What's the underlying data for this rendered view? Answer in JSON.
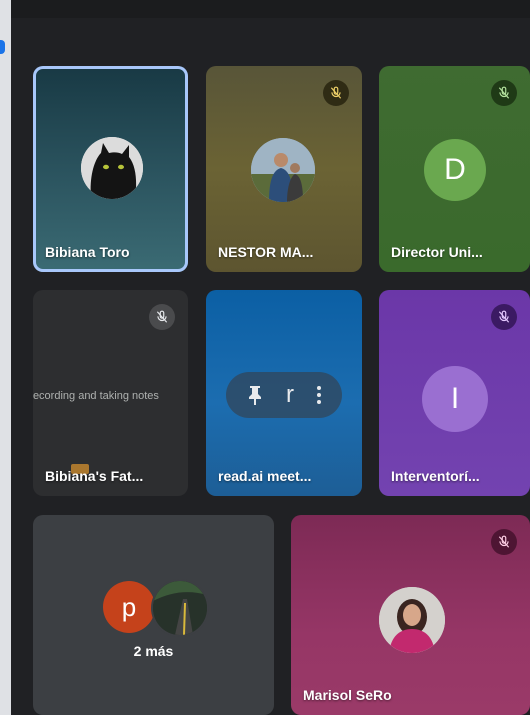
{
  "participants": [
    {
      "name": "Bibiana Toro"
    },
    {
      "name": "NESTOR MA..."
    },
    {
      "name": "Director Uni...",
      "initial": "D"
    },
    {
      "name": "Bibiana's Fat...",
      "caption": "Recording and taking notes"
    },
    {
      "name": "read.ai meet...",
      "control_letter": "r"
    },
    {
      "name": "Interventorí...",
      "initial": "I"
    },
    {
      "name": "Marisol SeRo"
    }
  ],
  "overflow": {
    "initial": "p",
    "label": "2 más"
  },
  "colors": {
    "speaking_border": "#a8c7fa",
    "background": "#202124",
    "muted_icon": "#ffffff"
  },
  "icons": [
    "mic-off-icon",
    "pin-icon",
    "more-options-icon"
  ]
}
